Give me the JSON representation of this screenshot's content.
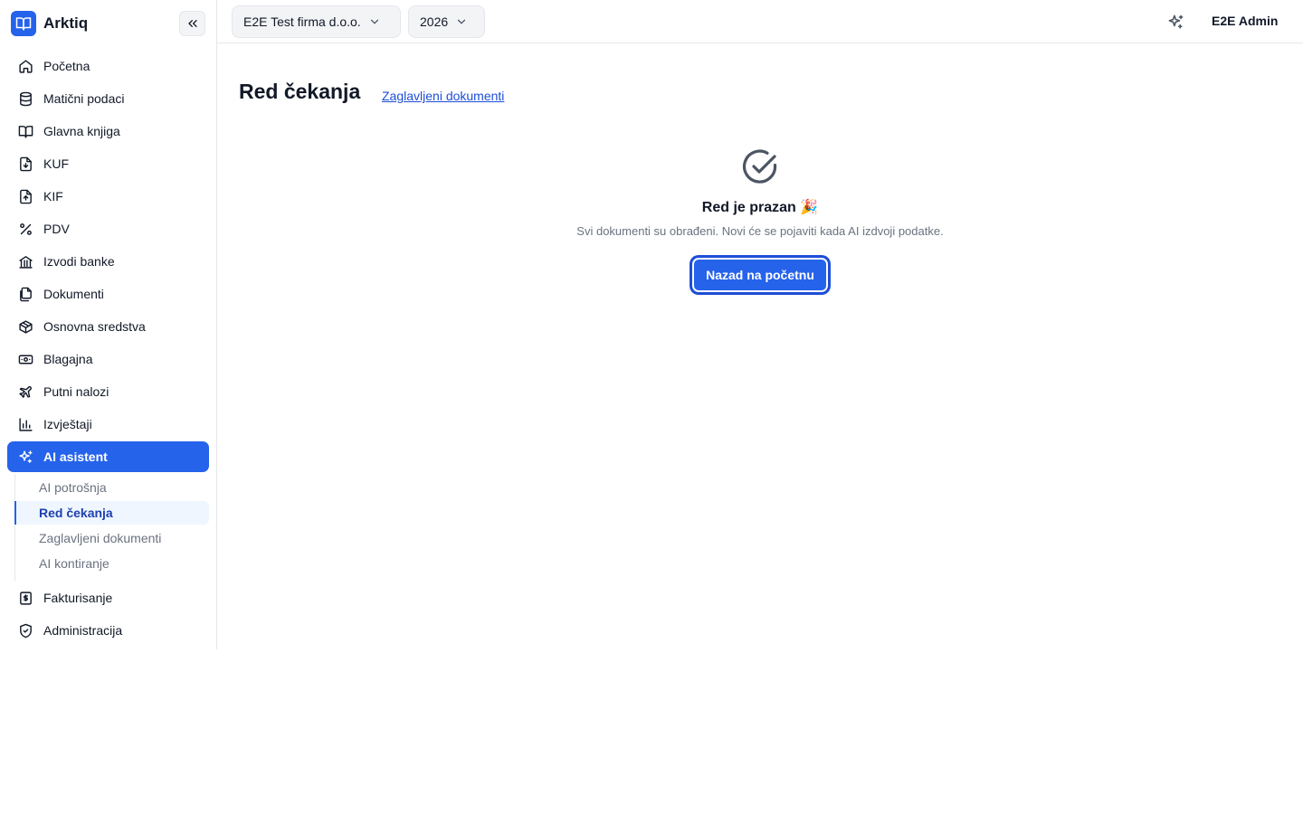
{
  "app": {
    "name": "Arktiq",
    "user": "E2E Admin",
    "company": "E2E Test firma d.o.o.",
    "year": "2026"
  },
  "sidebar": {
    "items": [
      {
        "label": "Početna",
        "icon": "home-icon"
      },
      {
        "label": "Matični podaci",
        "icon": "database-icon"
      },
      {
        "label": "Glavna knjiga",
        "icon": "book-icon"
      },
      {
        "label": "KUF",
        "icon": "file-download-icon"
      },
      {
        "label": "KIF",
        "icon": "file-upload-icon"
      },
      {
        "label": "PDV",
        "icon": "percent-icon"
      },
      {
        "label": "Izvodi banke",
        "icon": "bank-icon"
      },
      {
        "label": "Dokumenti",
        "icon": "documents-icon"
      },
      {
        "label": "Osnovna sredstva",
        "icon": "package-icon"
      },
      {
        "label": "Blagajna",
        "icon": "cash-icon"
      },
      {
        "label": "Putni nalozi",
        "icon": "plane-icon"
      },
      {
        "label": "Izvještaji",
        "icon": "bar-chart-icon"
      },
      {
        "label": "AI asistent",
        "icon": "sparkles-icon"
      }
    ],
    "ai_subitems": [
      {
        "label": "AI potrošnja"
      },
      {
        "label": "Red čekanja"
      },
      {
        "label": "Zaglavljeni dokumenti"
      },
      {
        "label": "AI kontiranje"
      }
    ],
    "bottom_items": [
      {
        "label": "Fakturisanje",
        "icon": "invoice-icon"
      },
      {
        "label": "Administracija",
        "icon": "shield-check-icon"
      }
    ]
  },
  "main": {
    "title": "Red čekanja",
    "link": "Zaglavljeni dokumenti",
    "empty": {
      "title": "Red je prazan 🎉",
      "subtitle": "Svi dokumenti su obrađeni. Novi će se pojaviti kada AI izdvoji podatke.",
      "button": "Nazad na početnu"
    }
  },
  "colors": {
    "accent": "#2563eb",
    "active_sub_bg": "#eff6ff",
    "border": "#e5e7eb",
    "muted_text": "#6b7280"
  }
}
